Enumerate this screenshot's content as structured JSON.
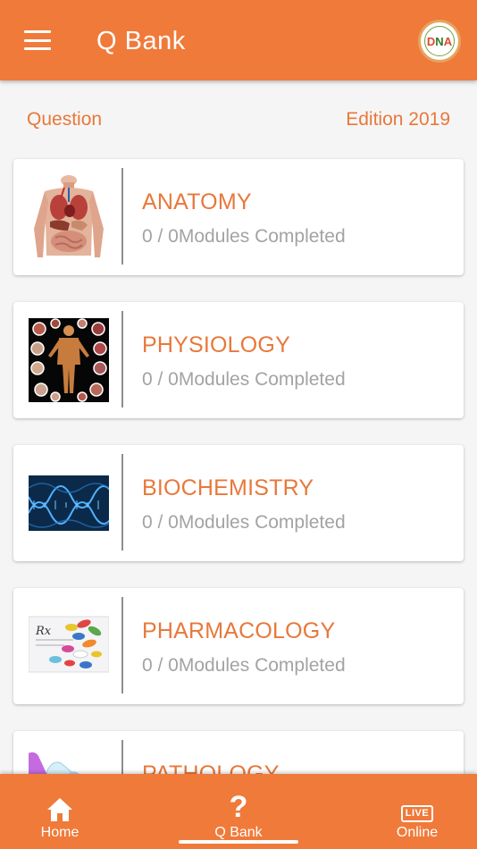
{
  "header": {
    "title": "Q Bank",
    "logo_text": "DNA",
    "accent_color": "#f07a3a"
  },
  "subheader": {
    "left": "Question",
    "right": "Edition 2019"
  },
  "subjects": [
    {
      "name": "ANATOMY",
      "progress": "0 / 0Modules Completed",
      "icon": "anatomy-image"
    },
    {
      "name": "PHYSIOLOGY",
      "progress": "0 / 0Modules Completed",
      "icon": "physiology-image"
    },
    {
      "name": "BIOCHEMISTRY",
      "progress": "0 / 0Modules Completed",
      "icon": "dna-helix-image"
    },
    {
      "name": "PHARMACOLOGY",
      "progress": "0 / 0Modules Completed",
      "icon": "pills-image"
    },
    {
      "name": "PATHOLOGY",
      "progress": "",
      "icon": "test-tubes-image"
    }
  ],
  "nav": {
    "home": "Home",
    "qbank": "Q Bank",
    "online": "Online",
    "live_badge": "LIVE",
    "qbank_glyph": "?"
  }
}
